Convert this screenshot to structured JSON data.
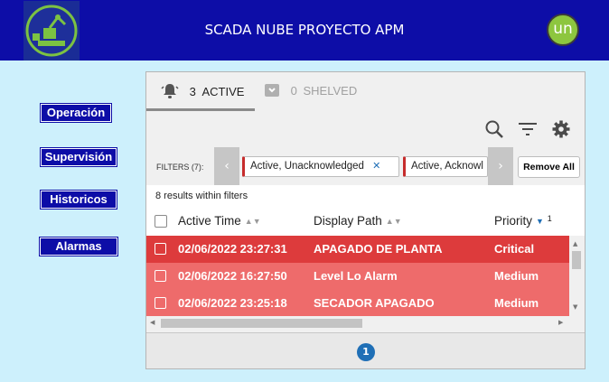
{
  "header": {
    "title": "SCADA NUBE PROYECTO APM",
    "badge": "un",
    "colors": {
      "bar": "#0d0da7",
      "badge": "#8dc63f"
    }
  },
  "nav": {
    "items": [
      {
        "label": "Operación"
      },
      {
        "label": "Supervisión"
      },
      {
        "label": "Historicos"
      },
      {
        "label": "Alarmas"
      }
    ]
  },
  "alarm_panel": {
    "tabs": [
      {
        "count": "3",
        "label": "ACTIVE",
        "icon": "bell-icon",
        "selected": true
      },
      {
        "count": "0",
        "label": "SHELVED",
        "icon": "shelve-icon",
        "selected": false
      }
    ],
    "toolbar_icons": [
      "search-icon",
      "filter-icon",
      "gear-icon"
    ],
    "filters": {
      "label": "FILTERS (7):",
      "chips": [
        "Active, Unacknowledged",
        "Active, Acknowl"
      ],
      "chip_close": "✕",
      "remove_all": "Remove All"
    },
    "results_text": "8 results within filters",
    "columns": [
      "Active Time",
      "Display Path",
      "Priority"
    ],
    "priority_sort_index": "1",
    "rows": [
      {
        "time": "02/06/2022 23:27:31",
        "path": "APAGADO DE PLANTA",
        "priority": "Critical",
        "color": "#dd3b3c"
      },
      {
        "time": "02/06/2022 16:27:50",
        "path": "Level Lo Alarm",
        "priority": "Medium",
        "color": "#ee6b6b"
      },
      {
        "time": "02/06/2022 23:25:18",
        "path": "SECADOR APAGADO",
        "priority": "Medium",
        "color": "#ee6b6b"
      }
    ],
    "pager": {
      "current_page": "1"
    }
  }
}
